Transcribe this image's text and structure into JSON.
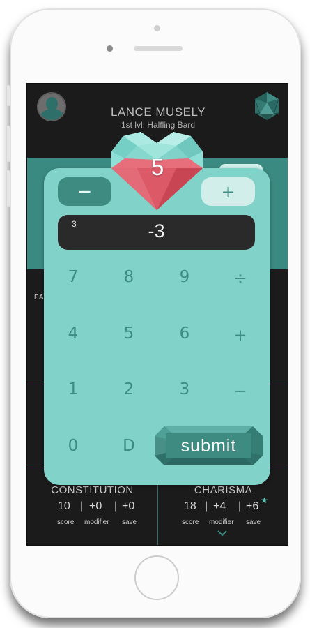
{
  "character": {
    "name": "LANCE MUSELY",
    "subtitle": "1st lvl. Halfling Bard"
  },
  "heart": {
    "value": "5"
  },
  "background": {
    "side_label": "PAS"
  },
  "stats": [
    {
      "name": "CONSTITUTION",
      "score": "10",
      "modifier": "+0",
      "save": "+0",
      "proficient": false
    },
    {
      "name": "CHARISMA",
      "score": "18",
      "modifier": "+4",
      "save": "+6",
      "proficient": true
    }
  ],
  "stat_captions": {
    "score": "score",
    "modifier": "modifier",
    "save": "save",
    "separator": "|"
  },
  "calculator": {
    "minus_label": "−",
    "plus_label": "+",
    "display_small": "3",
    "display_value": "-3",
    "keys": [
      "7",
      "8",
      "9",
      "÷",
      "4",
      "5",
      "6",
      "+",
      "1",
      "2",
      "3",
      "−",
      "0",
      "D"
    ],
    "submit_label": "submit"
  },
  "icons": {
    "avatar": "user-avatar-icon",
    "dice": "d20-icon",
    "star": "star-icon",
    "chevron": "chevron-down-icon"
  },
  "colors": {
    "teal": "#81d2c9",
    "teal_dark": "#3e8b82",
    "ruby": "#d65361",
    "screen_bg": "#1b1b1b"
  }
}
